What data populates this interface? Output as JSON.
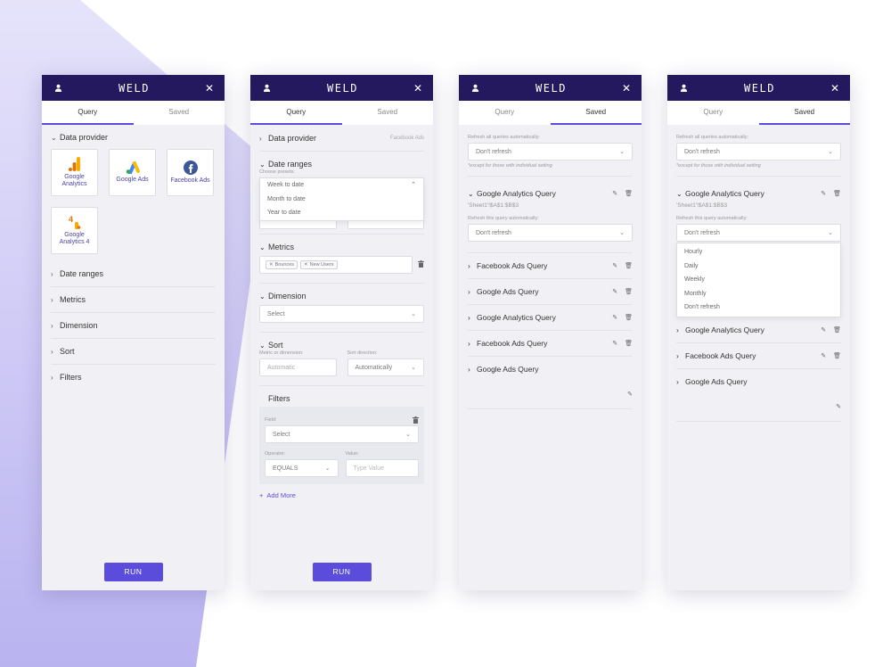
{
  "brand": "WELD",
  "tabs": {
    "query": "Query",
    "saved": "Saved"
  },
  "run_label": "RUN",
  "panel1": {
    "sections": {
      "data_provider": "Data provider",
      "date_ranges": "Date ranges",
      "metrics": "Metrics",
      "dimension": "Dimension",
      "sort": "Sort",
      "filters": "Filters"
    },
    "providers": [
      {
        "label": "Google Analytics",
        "icon": "google-analytics-icon"
      },
      {
        "label": "Google Ads",
        "icon": "google-ads-icon"
      },
      {
        "label": "Facebook Ads",
        "icon": "facebook-icon"
      },
      {
        "label": "Google Analytics 4",
        "icon": "google-analytics-4-icon"
      }
    ]
  },
  "panel2": {
    "data_provider": "Data provider",
    "data_provider_value": "Facebook Ads",
    "date_ranges": "Date ranges",
    "choose_presets": "Choose presets:",
    "presets": [
      "Week to date",
      "Month to date",
      "Year to date"
    ],
    "metrics": "Metrics",
    "metric_chips": [
      "Bounces",
      "New Users"
    ],
    "dimension": "Dimension",
    "dimension_placeholder": "Select",
    "sort": "Sort",
    "sort_metric_label": "Metric or dimension:",
    "sort_metric_placeholder": "Automatic",
    "sort_direction_label": "Sort direction:",
    "sort_direction_value": "Automatically",
    "filters": "Filters",
    "field_label": "Field:",
    "field_placeholder": "Select",
    "operator_label": "Operator:",
    "operator_value": "EQUALS",
    "value_label": "Value:",
    "value_placeholder": "Type Value",
    "add_more": "Add More"
  },
  "panel3": {
    "refresh_all_label": "Refresh all queries automatically:",
    "refresh_all_value": "Don't refresh",
    "refresh_note": "*except for those with individual setting",
    "expanded_query": {
      "name": "Google Analytics Query",
      "range": "'Sheet1'!$A$1:$B$3",
      "refresh_label": "Refresh this query automatically:",
      "refresh_value": "Don't refresh"
    },
    "queries": [
      "Facebook Ads Query",
      "Google Ads Query",
      "Google Analytics Query",
      "Facebook Ads Query",
      "Google Ads Query"
    ]
  },
  "panel4": {
    "refresh_all_label": "Refresh all queries automatically:",
    "refresh_all_value": "Don't refresh",
    "refresh_note": "*except for those with individual setting",
    "expanded_query": {
      "name": "Google Analytics Query",
      "range": "'Sheet1'!$A$1:$B$3",
      "refresh_label": "Refresh this query automatically:",
      "refresh_value": "Don't refresh"
    },
    "refresh_options": [
      "Hourly",
      "Daily",
      "Weekly",
      "Monthly",
      "Don't refresh"
    ],
    "queries": [
      "Google Analytics Query",
      "Facebook Ads Query",
      "Google Ads Query"
    ]
  },
  "colors": {
    "header": "#24195e",
    "accent": "#5b4cdc",
    "panel_bg": "#f1f1f5",
    "backdrop": "#c9c4f4"
  }
}
